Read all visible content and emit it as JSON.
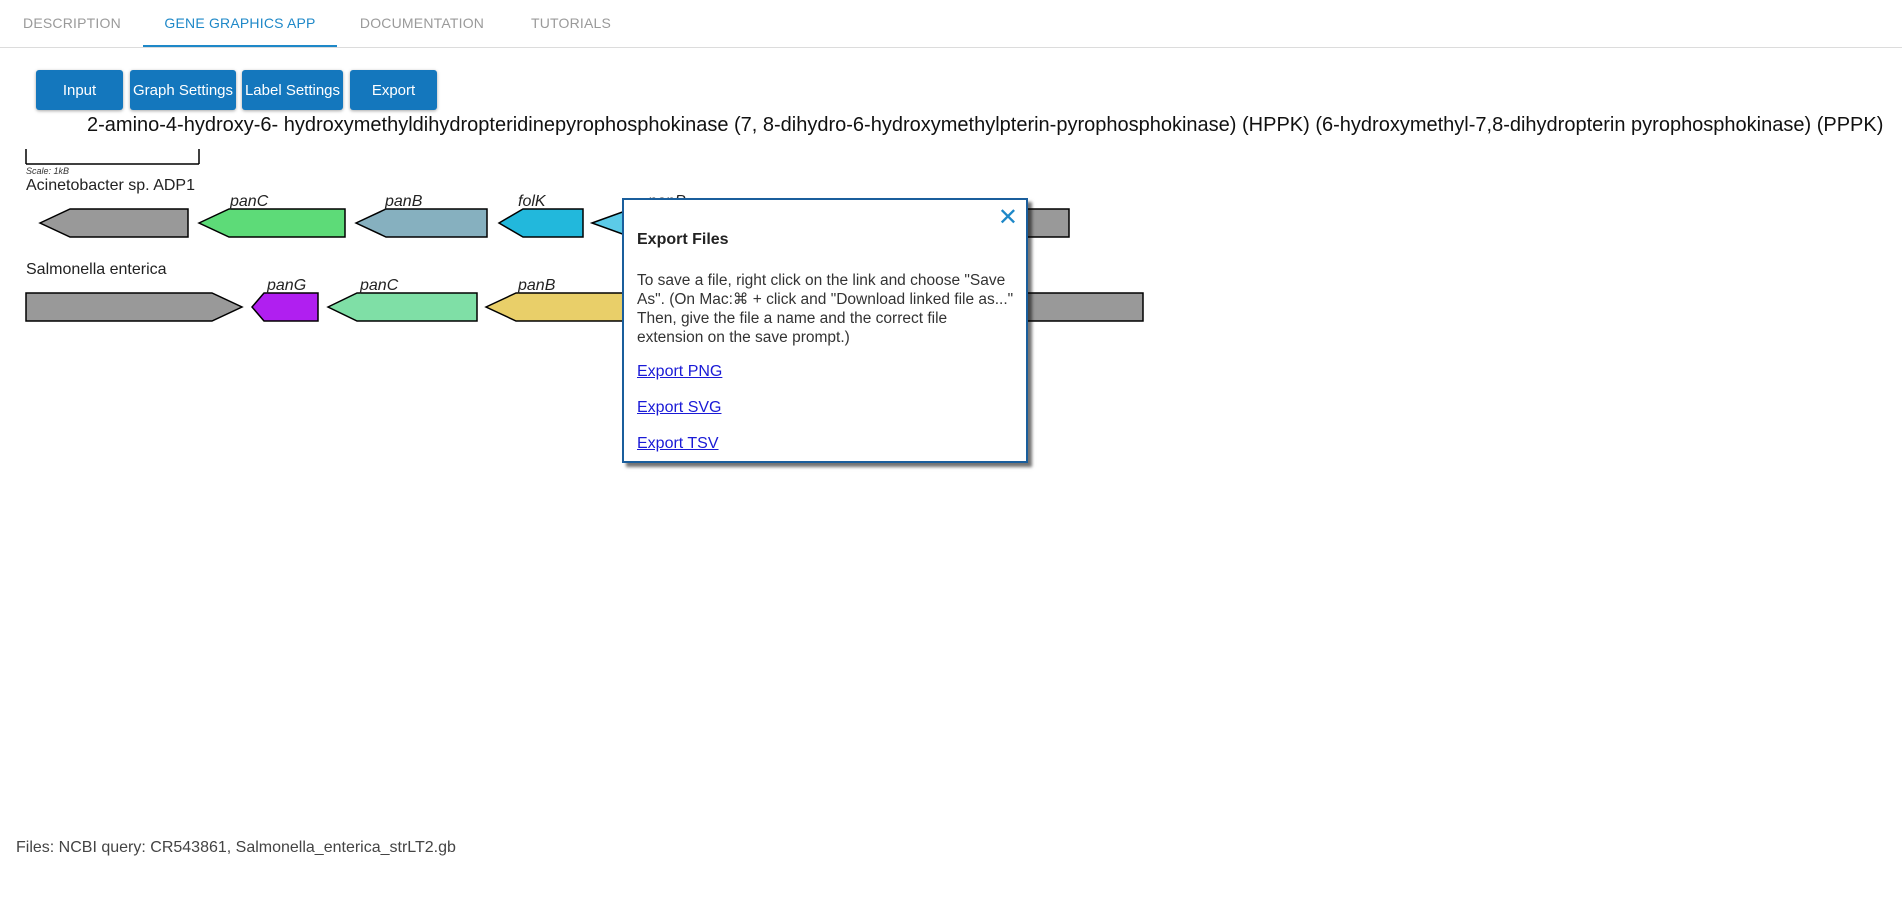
{
  "tabs": [
    {
      "label": "DESCRIPTION",
      "active": false
    },
    {
      "label": "GENE GRAPHICS APP",
      "active": true
    },
    {
      "label": "DOCUMENTATION",
      "active": false
    },
    {
      "label": "TUTORIALS",
      "active": false
    }
  ],
  "toolbar": {
    "input_label": "Input",
    "graph_settings_label": "Graph Settings",
    "label_settings_label": "Label Settings",
    "export_label": "Export"
  },
  "graph": {
    "title": "2-amino-4-hydroxy-6- hydroxymethyldihydropteridinepyrophosphokinase (7, 8-dihydro-6-hydroxymethylpterin-pyrophosphokinase) (HPPK) (6-hydroxymethyl-7,8-dihydropterin pyrophosphokinase) (PPPK)",
    "scale_label": "Scale: 1kB",
    "genomes": [
      {
        "name": "Acinetobacter sp. ADP1",
        "genes": [
          {
            "label": "",
            "color": "#999999"
          },
          {
            "label": "panC",
            "color": "#5ddb78"
          },
          {
            "label": "panB",
            "color": "#86b0bf"
          },
          {
            "label": "folK",
            "color": "#22b8dc"
          },
          {
            "label": "panP",
            "color": "#5ccbe8"
          },
          {
            "label": "",
            "color": "#999999"
          }
        ]
      },
      {
        "name": "Salmonella enterica",
        "genes": [
          {
            "label": "",
            "color": "#999999"
          },
          {
            "label": "panG",
            "color": "#b01ff0"
          },
          {
            "label": "panC",
            "color": "#7fdfa6"
          },
          {
            "label": "panB",
            "color": "#e9cf69"
          },
          {
            "label": "",
            "color": "#999999"
          }
        ]
      }
    ]
  },
  "export_modal": {
    "close_symbol": "✕",
    "title": "Export Files",
    "message": "To save a file, right click on the link and choose \"Save As\". (On Mac:⌘ + click and \"Download linked file as...\" Then, give the file a name and the correct file extension on the save prompt.)",
    "links": [
      "Export PNG",
      "Export SVG",
      "Export TSV"
    ]
  },
  "footer": {
    "files_text": "Files: NCBI query: CR543861, Salmonella_enterica_strLT2.gb"
  }
}
